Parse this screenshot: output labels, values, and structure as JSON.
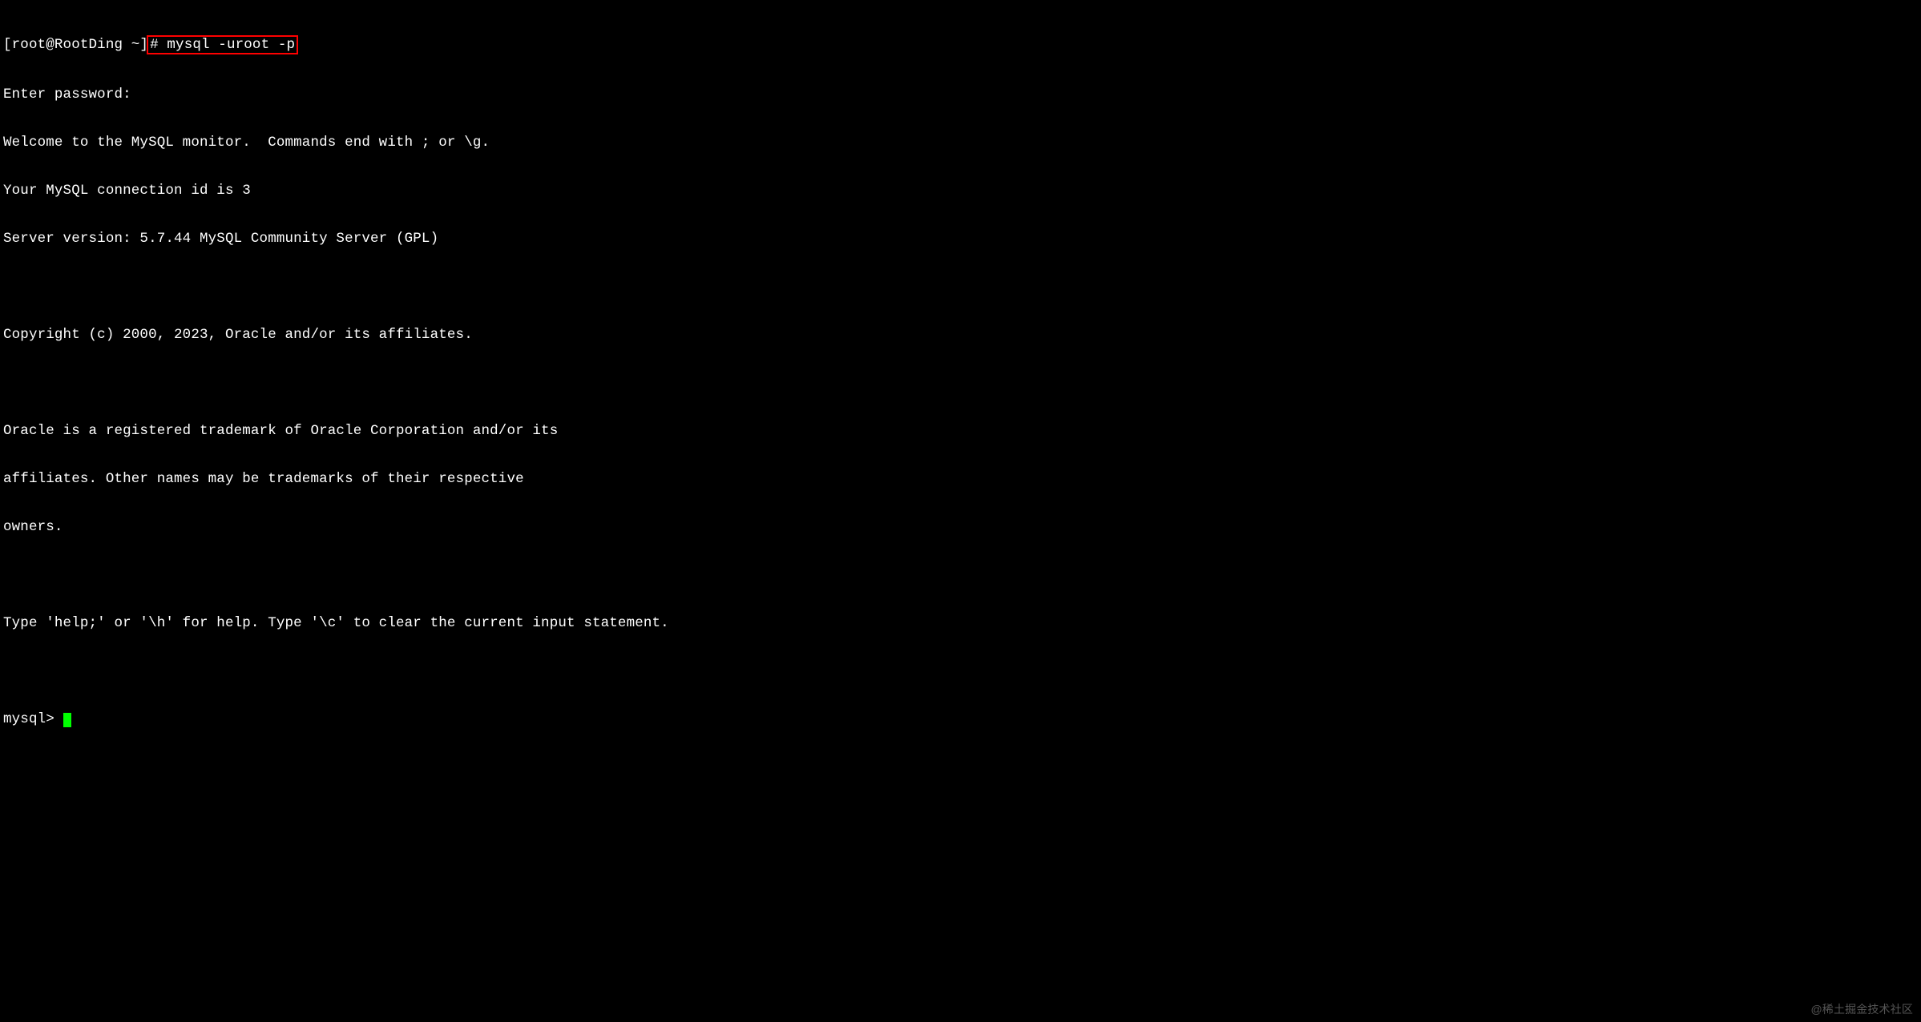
{
  "terminal": {
    "shell_prompt_prefix": "[root@RootDing ~]",
    "highlighted_command": "# mysql -uroot -p",
    "lines": [
      "Enter password:",
      "Welcome to the MySQL monitor.  Commands end with ; or \\g.",
      "Your MySQL connection id is 3",
      "Server version: 5.7.44 MySQL Community Server (GPL)",
      "",
      "Copyright (c) 2000, 2023, Oracle and/or its affiliates.",
      "",
      "Oracle is a registered trademark of Oracle Corporation and/or its",
      "affiliates. Other names may be trademarks of their respective",
      "owners.",
      "",
      "Type 'help;' or '\\h' for help. Type '\\c' to clear the current input statement.",
      ""
    ],
    "mysql_prompt": "mysql> "
  },
  "watermark": "@稀土掘金技术社区"
}
